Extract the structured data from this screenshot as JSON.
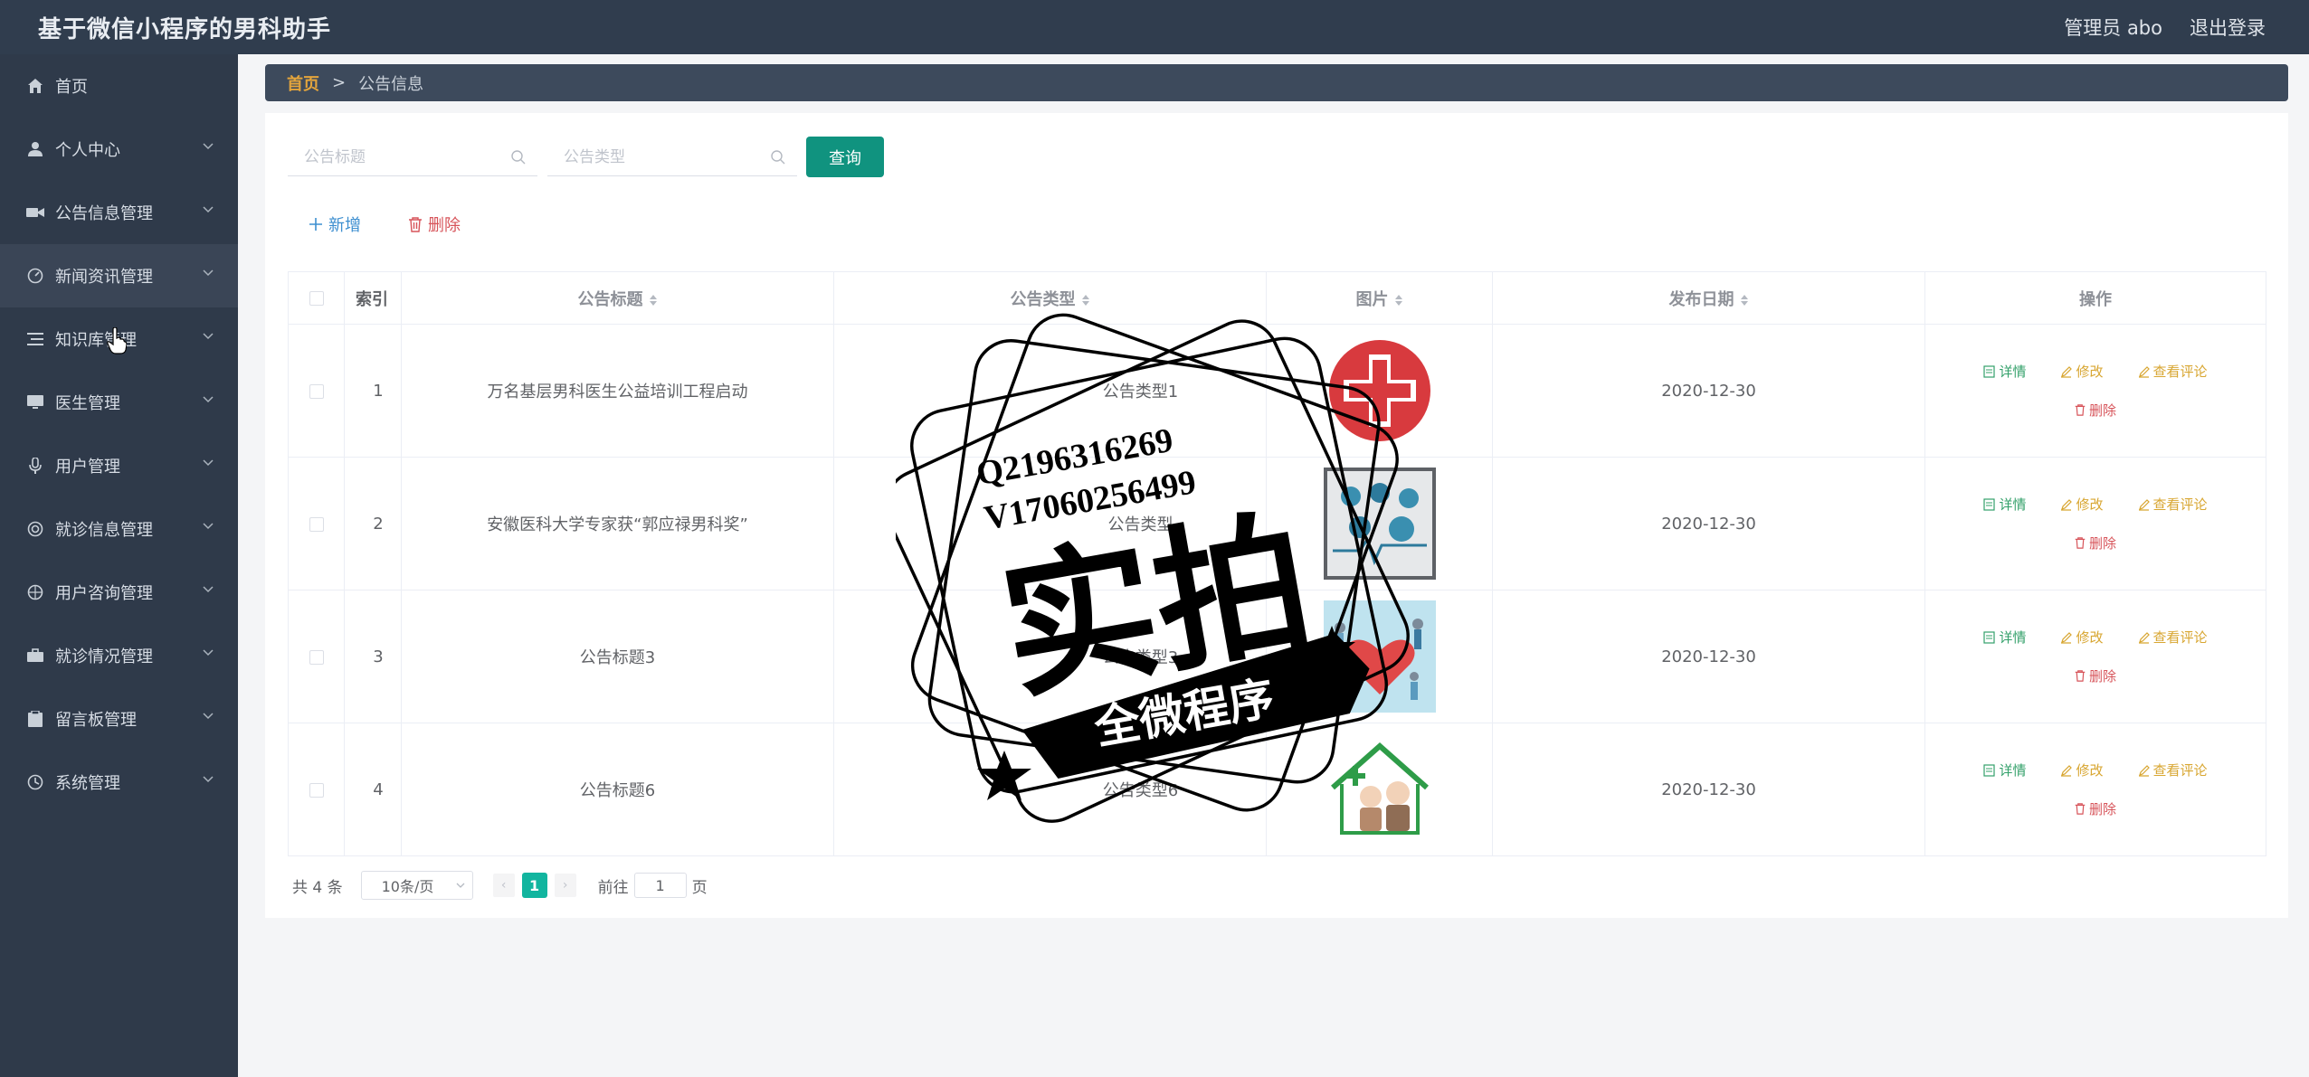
{
  "header": {
    "title": "基于微信小程序的男科助手",
    "user": "管理员 abo",
    "logout": "退出登录"
  },
  "sidebar": {
    "items": [
      {
        "label": "首页",
        "icon": "home-icon"
      },
      {
        "label": "个人中心",
        "icon": "user-icon"
      },
      {
        "label": "公告信息管理",
        "icon": "video-icon"
      },
      {
        "label": "新闻资讯管理",
        "icon": "dashboard-icon"
      },
      {
        "label": "知识库管理",
        "icon": "list-icon"
      },
      {
        "label": "医生管理",
        "icon": "monitor-icon"
      },
      {
        "label": "用户管理",
        "icon": "microphone-icon"
      },
      {
        "label": "就诊信息管理",
        "icon": "circle-icon"
      },
      {
        "label": "用户咨询管理",
        "icon": "compass-icon"
      },
      {
        "label": "就诊情况管理",
        "icon": "briefcase-icon"
      },
      {
        "label": "留言板管理",
        "icon": "clipboard-icon"
      },
      {
        "label": "系统管理",
        "icon": "clock-icon"
      }
    ]
  },
  "breadcrumb": {
    "home": "首页",
    "sep": ">",
    "current": "公告信息"
  },
  "search": {
    "title_placeholder": "公告标题",
    "type_placeholder": "公告类型",
    "query_label": "查询"
  },
  "actions": {
    "add_label": "新增",
    "delete_label": "删除"
  },
  "table": {
    "headers": {
      "index": "索引",
      "title": "公告标题",
      "type": "公告类型",
      "image": "图片",
      "date": "发布日期",
      "ops": "操作"
    },
    "rows": [
      {
        "index": "1",
        "title": "万名基层男科医生公益培训工程启动",
        "type": "公告类型1",
        "image": "red-cross-image",
        "date": "2020-12-30"
      },
      {
        "index": "2",
        "title": "安徽医科大学专家获“郭应禄男科奖”",
        "type": "公告类型",
        "image": "medical-icons-image",
        "date": "2020-12-30"
      },
      {
        "index": "3",
        "title": "公告标题3",
        "type": "公告类型3",
        "image": "health-illustration-image",
        "date": "2020-12-30"
      },
      {
        "index": "4",
        "title": "公告标题6",
        "type": "公告类型6",
        "image": "elderly-home-image",
        "date": "2020-12-30"
      }
    ],
    "ops": {
      "detail": "详情",
      "edit": "修改",
      "comment": "查看评论",
      "remove": "删除"
    }
  },
  "pagination": {
    "total": "共 4 条",
    "page_size": "10条/页",
    "current_page": "1",
    "goto_prefix": "前往",
    "goto_value": "1",
    "goto_suffix": "页"
  },
  "watermark": {
    "line1": "Q2196316269",
    "line2": "V17060256499",
    "big": "实拍",
    "banner": "全微程序"
  },
  "colors": {
    "header_bg": "#303d4e",
    "sidebar_bg": "#2f3a4a",
    "accent_teal": "#10937f",
    "page_active": "#12b59f",
    "breadcrumb_home": "#e4a53c",
    "danger": "#d7545a",
    "success": "#33a06a",
    "warning": "#d8a631"
  }
}
